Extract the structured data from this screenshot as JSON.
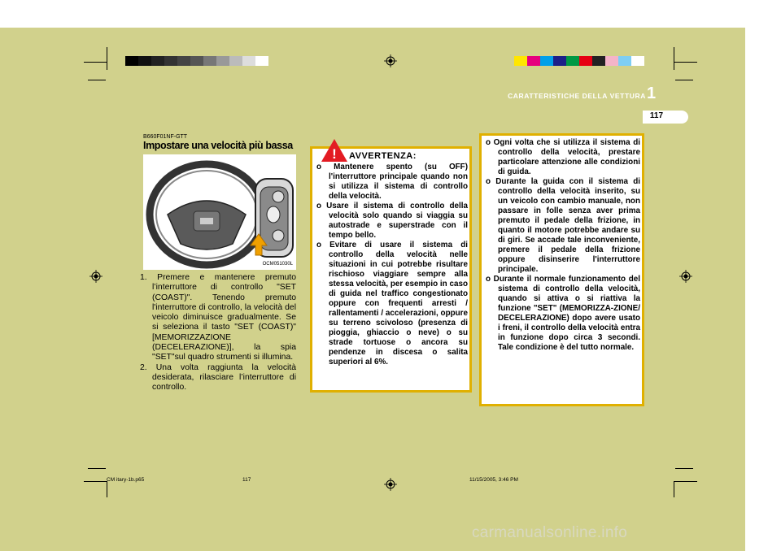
{
  "header": {
    "chapter_title": "CARATTERISTICHE DELLA VETTURA",
    "chapter_number": "1",
    "page_number": "117"
  },
  "colors": {
    "background": "#d1d18c",
    "box_border": "#e0b000",
    "warning_red": "#e31b23"
  },
  "section": {
    "code": "B660F01NF-GTT",
    "title": "Impostare una velocità più bassa"
  },
  "figure": {
    "code": "OCM051030L"
  },
  "steps": [
    "1. Premere e mantenere premuto l’interruttore di controllo \"SET (COAST)\". Tenendo premuto l'interruttore di controllo, la velocità del veicolo diminuisce gradualmente. Se si seleziona il tasto \"SET (COAST)\" [MEMORIZZAZIONE (DECELERAZIONE)], la spia \"SET\"sul quadro strumenti si illumina.",
    "2. Una volta raggiunta la velocità desiderata, rilasciare l’interruttore di controllo."
  ],
  "warning": {
    "icon": "!",
    "title": "AVVERTENZA:",
    "items": [
      "o Mantenere spento (su OFF) l'interruttore principale quando non si utilizza il sistema di controllo della velocità.",
      "o Usare il sistema di controllo della velocità solo quando si viaggia su autostrade e superstrade con il tempo bello.",
      "o Evitare di usare il sistema di controllo della velocità nelle situazioni in cui potrebbe risultare rischioso viaggiare sempre alla stessa velocità, per esempio in caso di guida nel traffico congestionato oppure con frequenti arresti / rallentamenti / accelerazioni, oppure su terreno scivoloso (presenza di pioggia, ghiaccio o neve) o su strade tortuose o ancora su pendenze in discesa o salita superiori al 6%."
    ]
  },
  "warning_continued": {
    "items": [
      "o Ogni volta che si utilizza il sistema di controllo della velocità, prestare particolare attenzione alle condizioni di guida.",
      "o Durante la guida con il sistema di controllo della velocità inserito, su un veicolo con cambio manuale, non passare in folle senza aver prima premuto il pedale della frizione, in quanto il motore potrebbe andare su di giri. Se accade tale inconveniente, premere il pedale della frizione oppure disinserire l'interruttore principale.",
      "o Durante il normale funzionamento del sistema di controllo della velocità, quando si attiva o si riattiva la funzione \"SET\" (MEMORIZZA-ZIONE/ DECELERAZIONE) dopo avere usato i freni, il controllo della velocità entra in funzione dopo circa 3 secondi. Tale condizione è del tutto normale."
    ]
  },
  "footer": {
    "file": "CM itary-1b.p65",
    "page": "117",
    "date": "11/15/2005, 3:46 PM"
  },
  "watermark": "carmanualsonline.info"
}
